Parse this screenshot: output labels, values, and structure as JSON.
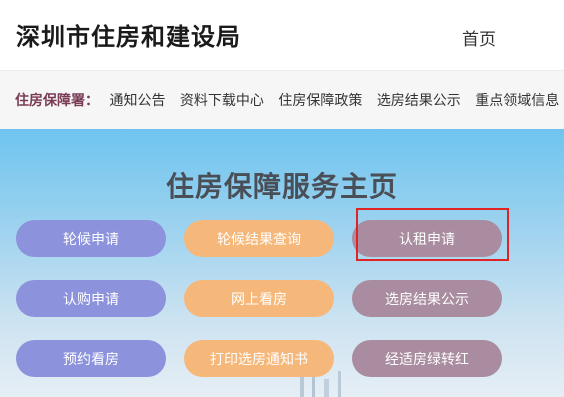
{
  "header": {
    "site_title": "深圳市住房和建设局",
    "home_link": "首页"
  },
  "nav": {
    "label": "住房保障署：",
    "items": [
      "通知公告",
      "资料下载中心",
      "住房保障政策",
      "选房结果公示",
      "重点领域信息"
    ]
  },
  "hero": {
    "title": "住房保障服务主页"
  },
  "services": {
    "lunhou_apply": "轮候申请",
    "lunhou_result": "轮候结果查询",
    "rent_apply": "认租申请",
    "buy_apply": "认购申请",
    "online_view": "网上看房",
    "select_result": "选房结果公示",
    "book_view": "预约看房",
    "print_notice": "打印选房通知书",
    "eco_convert": "经适房绿转红"
  },
  "colors": {
    "blue_button": "#8c93dc",
    "orange_button": "#f6b87a",
    "mauve_button": "#a98ca0",
    "highlight": "#e02424"
  }
}
